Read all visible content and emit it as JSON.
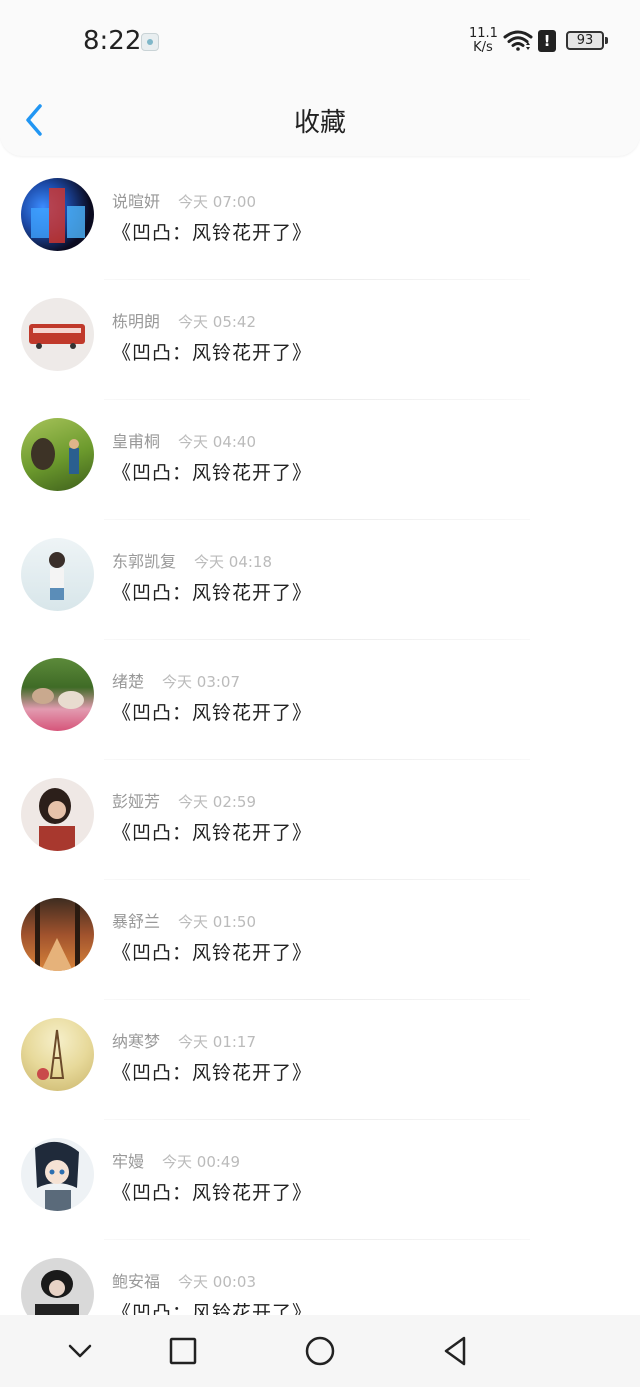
{
  "status": {
    "time": "8:22",
    "net_speed_value": "11.1",
    "net_speed_unit": "K/s",
    "battery": "93"
  },
  "header": {
    "title": "收藏"
  },
  "favorites": [
    {
      "name": "说暄妍",
      "time": "今天 07:00",
      "message": "《凹凸：风铃花开了》"
    },
    {
      "name": "栋明朗",
      "time": "今天 05:42",
      "message": "《凹凸：风铃花开了》"
    },
    {
      "name": "皇甫桐",
      "time": "今天 04:40",
      "message": "《凹凸：风铃花开了》"
    },
    {
      "name": "东郭凯复",
      "time": "今天 04:18",
      "message": "《凹凸：风铃花开了》"
    },
    {
      "name": "绪楚",
      "time": "今天 03:07",
      "message": "《凹凸：风铃花开了》"
    },
    {
      "name": "彭娅芳",
      "time": "今天 02:59",
      "message": "《凹凸：风铃花开了》"
    },
    {
      "name": "暴舒兰",
      "time": "今天 01:50",
      "message": "《凹凸：风铃花开了》"
    },
    {
      "name": "纳寒梦",
      "time": "今天 01:17",
      "message": "《凹凸：风铃花开了》"
    },
    {
      "name": "牢嫚",
      "time": "今天 00:49",
      "message": "《凹凸：风铃花开了》"
    },
    {
      "name": "鲍安福",
      "time": "今天 00:03",
      "message": "《凹凸：风铃花开了》"
    }
  ],
  "colors": {
    "accent": "#2196f3",
    "background": "#ffffff",
    "header_bg": "#fafafa"
  }
}
